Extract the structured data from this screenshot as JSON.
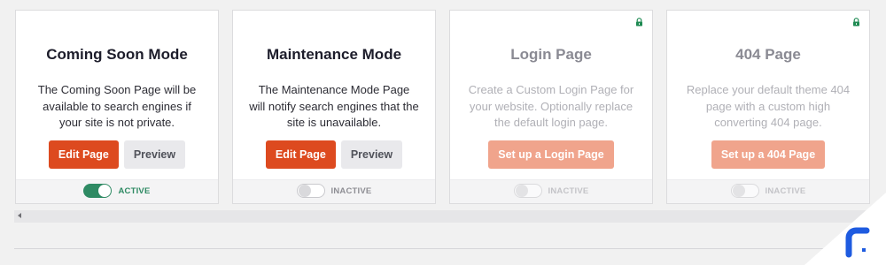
{
  "cards": [
    {
      "title": "Coming Soon Mode",
      "description": "The Coming Soon Page will be available to search engines if your site is not private.",
      "primary_button": "Edit Page",
      "secondary_button": "Preview",
      "status": "ACTIVE",
      "toggle_on": true,
      "locked": false
    },
    {
      "title": "Maintenance Mode",
      "description": "The Maintenance Mode Page will notify search engines that the site is unavailable.",
      "primary_button": "Edit Page",
      "secondary_button": "Preview",
      "status": "INACTIVE",
      "toggle_on": false,
      "locked": false
    },
    {
      "title": "Login Page",
      "description": "Create a Custom Login Page for your website. Optionally replace the default login page.",
      "setup_button": "Set up a Login Page",
      "status": "INACTIVE",
      "toggle_on": false,
      "locked": true,
      "lock_icon": "lock-icon"
    },
    {
      "title": "404 Page",
      "description": "Replace your default theme 404 page with a custom high converting 404 page.",
      "setup_button": "Set up a 404 Page",
      "status": "INACTIVE",
      "toggle_on": false,
      "locked": true,
      "lock_icon": "lock-icon"
    }
  ],
  "colors": {
    "primary": "#dd4a1f",
    "primary_muted": "#f0a48c",
    "active_green": "#2e8a63",
    "lock_green": "#1e8a52",
    "logo_blue": "#1e5be0"
  },
  "scrollbar": {
    "arrow_icon": "left-arrow-icon"
  },
  "logo": {
    "icon": "brand-logo-icon"
  }
}
